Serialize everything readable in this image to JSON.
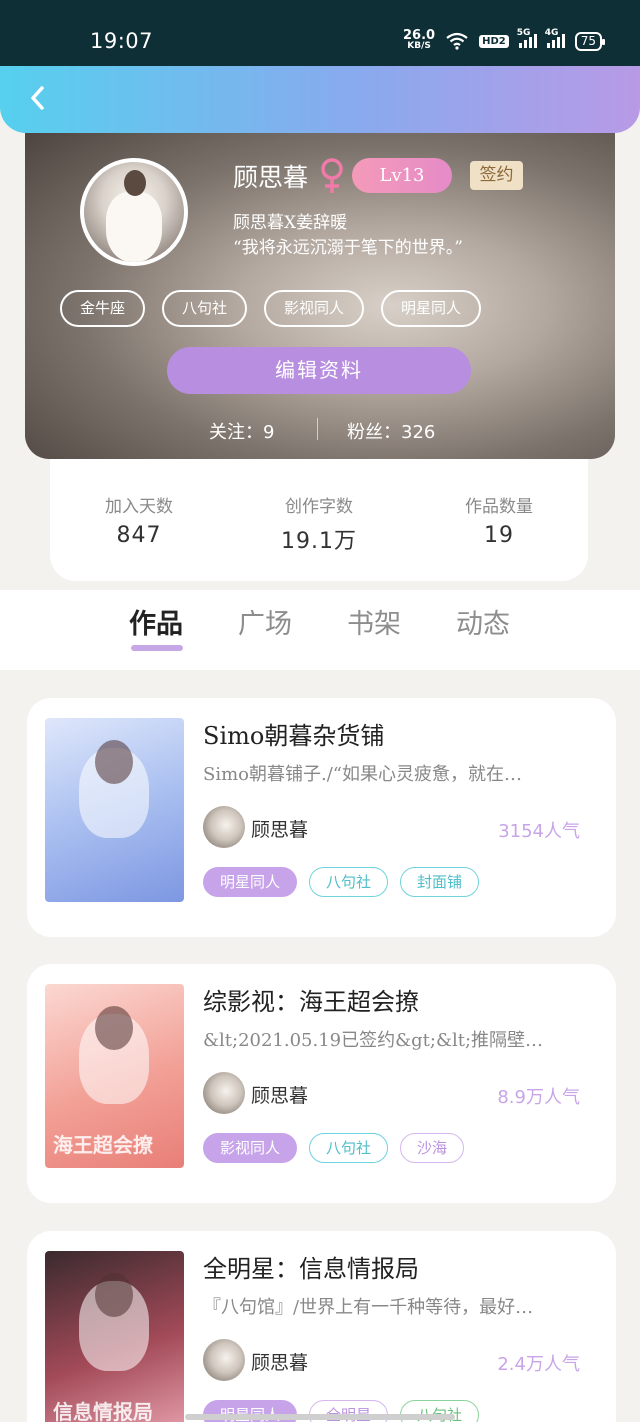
{
  "status_bar": {
    "time": "19:07",
    "net_speed_value": "26.0",
    "net_speed_unit": "KB/S",
    "hd_label": "HD2",
    "signal1_label": "5G",
    "signal2_label": "4G",
    "battery": "75"
  },
  "profile": {
    "name": "顾思暮",
    "level": "Lv13",
    "sign_badge": "签约",
    "bio_line1": "顾思暮X姜辞暖",
    "bio_line2": "“我将永远沉溺于笔下的世界。”",
    "tags": [
      "金牛座",
      "八句社",
      "影视同人",
      "明星同人"
    ],
    "edit_button": "编辑资料",
    "following": "关注：9",
    "fans": "粉丝：326"
  },
  "stats": [
    {
      "label": "加入天数",
      "value": "847"
    },
    {
      "label": "创作字数",
      "value": "19.1万"
    },
    {
      "label": "作品数量",
      "value": "19"
    }
  ],
  "tabs": [
    {
      "label": "作品",
      "active": true
    },
    {
      "label": "广场",
      "active": false
    },
    {
      "label": "书架",
      "active": false
    },
    {
      "label": "动态",
      "active": false
    }
  ],
  "works": [
    {
      "title": "Simo朝暮杂货铺",
      "description": "Simo朝暮铺子./“如果心灵疲惫，就在…",
      "author": "顾思暮",
      "popularity": "3154人气",
      "tags": [
        "明星同人",
        "八句社",
        "封面铺"
      ]
    },
    {
      "title": "综影视：海王超会撩",
      "description": "&lt;2021.05.19已签约&gt;&lt;推隔壁…",
      "author": "顾思暮",
      "popularity": "8.9万人气",
      "cover_text": "海王超会撩",
      "tags": [
        "影视同人",
        "八句社",
        "沙海"
      ]
    },
    {
      "title": "全明星：信息情报局",
      "description": "『八句馆』/世界上有一千种等待，最好…",
      "author": "顾思暮",
      "popularity": "2.4万人气",
      "cover_text": "信息情报局",
      "tags": [
        "明星同人",
        "全明星",
        "八句社"
      ]
    }
  ],
  "colors": {
    "accent_purple": "#c7a4e9",
    "nav_gradient_start": "#56d0ee",
    "nav_gradient_end": "#b89ae6"
  }
}
